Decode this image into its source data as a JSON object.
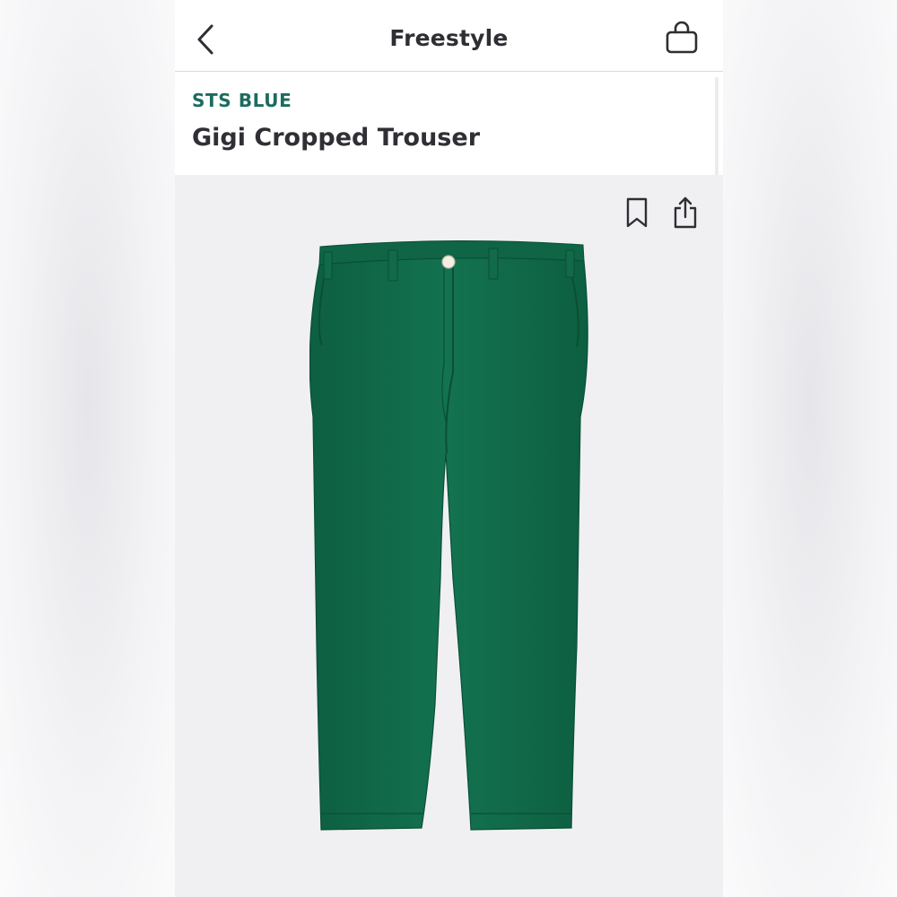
{
  "nav": {
    "title": "Freestyle",
    "back_icon": "chevron-left-icon",
    "bag_icon": "shopping-bag-icon"
  },
  "product": {
    "brand": "STS BLUE",
    "name": "Gigi Cropped Trouser",
    "color_hex": "#116a4a",
    "image_alt": "Green cropped trouser"
  },
  "actions": {
    "bookmark_icon": "bookmark-icon",
    "share_icon": "share-icon"
  },
  "colors": {
    "brand_text": "#1d6b5f",
    "title_text": "#2e2e33",
    "gallery_bg": "#f0f0f3"
  }
}
